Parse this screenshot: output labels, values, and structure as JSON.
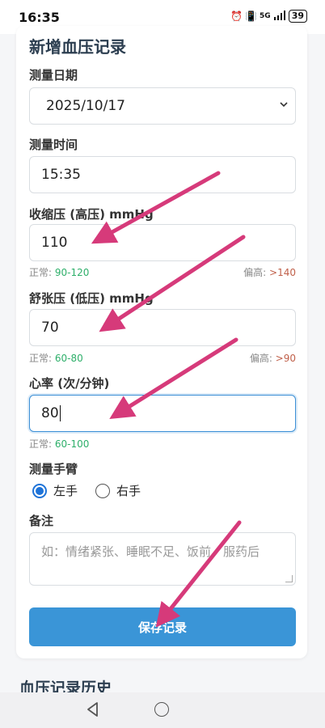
{
  "status_bar": {
    "time": "16:35",
    "network": "5G",
    "battery": "39"
  },
  "form": {
    "title": "新增血压记录",
    "date": {
      "label": "测量日期",
      "value": "2025/10/17"
    },
    "time": {
      "label": "测量时间",
      "value": "15:35"
    },
    "systolic": {
      "label": "收缩压 (高压) mmHg",
      "value": "110",
      "normal_label": "正常: ",
      "normal_range": "90-120",
      "high_label": "偏高: ",
      "high_value": ">140"
    },
    "diastolic": {
      "label": "舒张压 (低压) mmHg",
      "value": "70",
      "normal_label": "正常: ",
      "normal_range": "60-80",
      "high_label": "偏高: ",
      "high_value": ">90"
    },
    "heart_rate": {
      "label": "心率 (次/分钟)",
      "value": "80",
      "normal_label": "正常: ",
      "normal_range": "60-100"
    },
    "arm": {
      "label": "测量手臂",
      "options": [
        "左手",
        "右手"
      ],
      "selected": "左手"
    },
    "notes": {
      "label": "备注",
      "placeholder": "如：情绪紧张、睡眠不足、饭前、服药后"
    },
    "save_label": "保存记录"
  },
  "history": {
    "title": "血压记录历史"
  },
  "colors": {
    "accent": "#3a95d7",
    "normal": "#2eaf6a",
    "high": "#c0604a",
    "annotation_arrow": "#d63a7a"
  }
}
